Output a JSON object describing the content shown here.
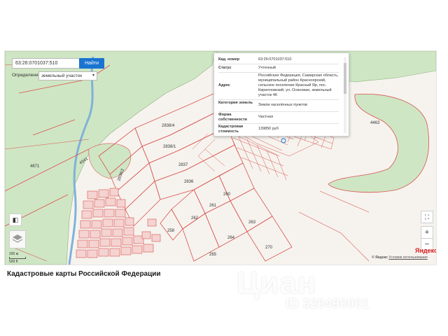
{
  "search": {
    "value": "63:26:0701037:510",
    "button": "Найти"
  },
  "definition": {
    "label": "Определение",
    "selected": "земельный участок"
  },
  "popup": {
    "rows": [
      {
        "key": "Кад. номер",
        "value": "63:26:0701037:510"
      },
      {
        "key": "Статус",
        "value": "Учтенный"
      },
      {
        "key": "Адрес",
        "value": "Российская Федерация, Самарская область, муниципальный район Красноярский, сельское поселение Красный Яр, пос. Кирилловский, ул. Осиновая, земельный участок 46"
      },
      {
        "key": "Категория земель",
        "value": "Земли населённых пунктов"
      },
      {
        "key": "Форма собственности",
        "value": "Частная"
      },
      {
        "key": "Кадастровая стоимость",
        "value": "139850 руб"
      }
    ]
  },
  "controls": {
    "fullscreen_icon": "fullscreen-icon",
    "zoom_in": "+",
    "zoom_out": "−",
    "layers_icon": "layers-icon"
  },
  "scale": {
    "top": "200 м",
    "bottom": "500 ft"
  },
  "attribution": {
    "brand": "© Яндекс",
    "link": "Условия использования"
  },
  "yandex_logo": "Яндекс",
  "parcels": {
    "p2838_4": "2838/4",
    "p2838_1": "2838/1",
    "p2837": "2837",
    "p2836": "2836",
    "p261": "261",
    "p260": "260",
    "p262": "262",
    "p258": "258",
    "p263": "263",
    "p264": "264",
    "p270": "270",
    "p265": "265",
    "p4671": "4671",
    "p4463": "4463",
    "p2838_2": "2838/2",
    "p4941": "4941"
  },
  "footer_title": "Кадастровые карты Российской Федерации",
  "watermark": {
    "logo": "Циан",
    "id": "ID 320490001"
  },
  "colors": {
    "parcel_line": "#d9534f",
    "forest": "#cfe6c4",
    "button": "#1a73d1",
    "background": "#f6f3ee"
  }
}
